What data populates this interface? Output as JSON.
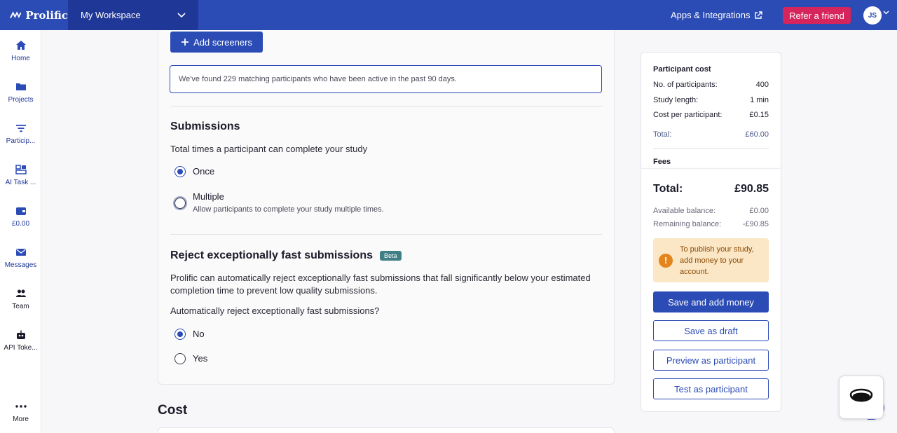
{
  "topbar": {
    "brand": "Prolific",
    "workspace": "My Workspace",
    "apps_label": "Apps & Integrations",
    "refer_label": "Refer a friend",
    "avatar_initials": "JS"
  },
  "sidebar": {
    "items": [
      {
        "label": "Home",
        "icon": "home-icon"
      },
      {
        "label": "Projects",
        "icon": "folder-icon"
      },
      {
        "label": "Particip...",
        "icon": "filter-icon"
      },
      {
        "label": "AI Task ...",
        "icon": "dashboard-icon"
      },
      {
        "label": "£0.00",
        "icon": "wallet-icon"
      },
      {
        "label": "Messages",
        "icon": "envelope-icon"
      },
      {
        "label": "Team",
        "icon": "people-icon"
      },
      {
        "label": "API Toke...",
        "icon": "robot-icon"
      },
      {
        "label": "More",
        "icon": "more-icon"
      }
    ]
  },
  "main": {
    "add_screeners_label": "Add screeners",
    "match_text": "We've found 229 matching participants who have been active in the past 90 days.",
    "submissions": {
      "title": "Submissions",
      "question": "Total times a participant can complete your study",
      "options": [
        {
          "label": "Once",
          "checked": true
        },
        {
          "label": "Multiple",
          "sub": "Allow participants to complete your study multiple times.",
          "checked": false
        }
      ]
    },
    "reject": {
      "title": "Reject exceptionally fast submissions",
      "badge": "Beta",
      "description": "Prolific can automatically reject exceptionally fast submissions that fall significantly below your estimated completion time to prevent low quality submissions.",
      "question": "Automatically reject exceptionally fast submissions?",
      "options": [
        {
          "label": "No",
          "checked": true
        },
        {
          "label": "Yes",
          "checked": false
        }
      ]
    },
    "cost_heading": "Cost"
  },
  "panel": {
    "title": "Participant cost",
    "rows": [
      {
        "label": "No. of participants:",
        "value": "400"
      },
      {
        "label": "Study length:",
        "value": "1 min"
      },
      {
        "label": "Cost per participant:",
        "value": "£0.15"
      }
    ],
    "subtotal": {
      "label": "Total:",
      "value": "£60.00"
    },
    "fees_label": "Fees",
    "grand_total": {
      "label": "Total:",
      "value": "£90.85"
    },
    "available": {
      "label": "Available balance:",
      "value": "£0.00"
    },
    "remaining": {
      "label": "Remaining balance:",
      "value": "-£90.85"
    },
    "warning": "To publish your study, add money to your account.",
    "buttons": {
      "save_add_money": "Save and add money",
      "save_draft": "Save as draft",
      "preview": "Preview as participant",
      "test": "Test as participant"
    }
  },
  "colors": {
    "brand_blue": "#2b4bb5",
    "refer_pink": "#d6245d",
    "warning_bg": "#fbe6c6",
    "beta_teal": "#3f7f86"
  }
}
